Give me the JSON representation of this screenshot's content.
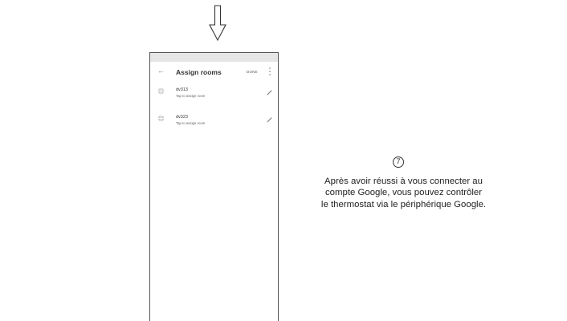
{
  "app_bar": {
    "back_icon": "←",
    "title": "Assign rooms",
    "done_label": "DONE",
    "more_icon": "more-vert-icon"
  },
  "devices": [
    {
      "name": "dv313",
      "subtitle": "Tap to assign room",
      "icon": "device-icon",
      "action_icon": "edit-pencil-icon"
    },
    {
      "name": "dv323",
      "subtitle": "Tap to assign room",
      "icon": "device-icon",
      "action_icon": "edit-pencil-icon"
    }
  ],
  "instruction": {
    "step_number": "7",
    "lines": [
      "Après avoir réussi à vous connecter au",
      "compte Google, vous pouvez contrôler",
      "le thermostat via le périphérique Google."
    ]
  },
  "colors": {
    "status_bar": "#e6e6e6",
    "frame": "#555555",
    "text": "#222222"
  }
}
